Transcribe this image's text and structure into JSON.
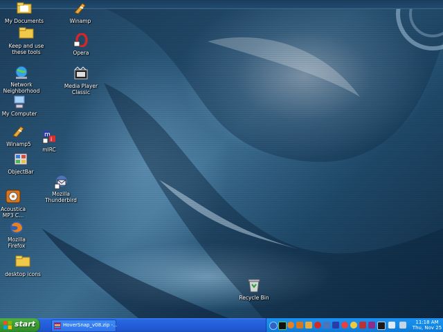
{
  "desktop": {
    "icons": [
      {
        "label": "My Documents"
      },
      {
        "label": "Keep and use\nthese tools"
      },
      {
        "label": "Network\nNeighborhood"
      },
      {
        "label": "My Computer"
      },
      {
        "label": "Winamp5"
      },
      {
        "label": "ObjectBar"
      },
      {
        "label": "Acoustica\nMP3 C..."
      },
      {
        "label": "Mozilla\nFirefox"
      },
      {
        "label": "desktop icons"
      },
      {
        "label": "Winamp"
      },
      {
        "label": "Opera"
      },
      {
        "label": "Media Player\nClassic"
      },
      {
        "label": "mIRC"
      },
      {
        "label": "Mozilla\nThunderbird"
      },
      {
        "label": "Recycle Bin"
      }
    ]
  },
  "taskbar": {
    "start_label": "start",
    "task_label": "HoverSnap_v08.zip -...",
    "clock_time": "11:18 AM",
    "clock_date": "Thu, Nov 25"
  },
  "colors": {
    "taskbar_blue": "#245edb",
    "start_green": "#3c9a35",
    "tray_blue": "#138be8"
  }
}
